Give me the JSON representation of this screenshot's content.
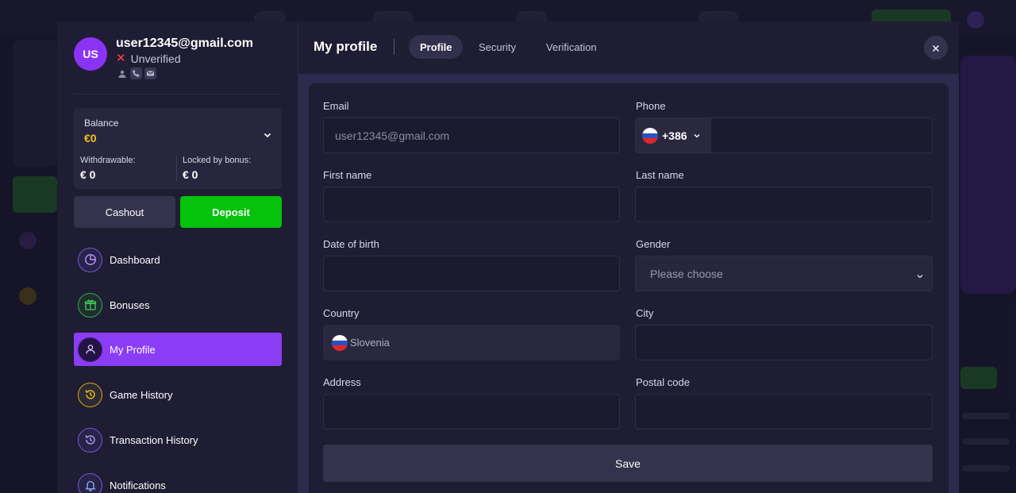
{
  "user": {
    "initials": "US",
    "email": "user12345@gmail.com",
    "status": "Unverified"
  },
  "balance": {
    "label": "Balance",
    "value": "€0",
    "withdrawable_label": "Withdrawable:",
    "withdrawable_value": "€ 0",
    "locked_label": "Locked by bonus:",
    "locked_value": "€ 0"
  },
  "actions": {
    "cashout": "Cashout",
    "deposit": "Deposit"
  },
  "nav": {
    "items": [
      {
        "label": "Dashboard",
        "icon": "pie-chart-icon"
      },
      {
        "label": "Bonuses",
        "icon": "gift-icon"
      },
      {
        "label": "My Profile",
        "icon": "user-icon",
        "active": true
      },
      {
        "label": "Game History",
        "icon": "history-icon"
      },
      {
        "label": "Transaction History",
        "icon": "history-icon"
      },
      {
        "label": "Notifications",
        "icon": "bell-icon"
      }
    ]
  },
  "header": {
    "title": "My profile",
    "tabs": [
      {
        "label": "Profile",
        "active": true
      },
      {
        "label": "Security"
      },
      {
        "label": "Verification"
      }
    ]
  },
  "form": {
    "email_label": "Email",
    "email_value": "user12345@gmail.com",
    "phone_label": "Phone",
    "phone_code": "+386",
    "first_name_label": "First name",
    "last_name_label": "Last name",
    "dob_label": "Date of birth",
    "gender_label": "Gender",
    "gender_placeholder": "Please choose",
    "country_label": "Country",
    "country_value": "Slovenia",
    "city_label": "City",
    "address_label": "Address",
    "postal_label": "Postal code",
    "save": "Save"
  },
  "colors": {
    "accent": "#8b3df5",
    "deposit_green": "#05c20a",
    "balance_gold": "#f2c21a",
    "unverified_red": "#ff4040"
  }
}
